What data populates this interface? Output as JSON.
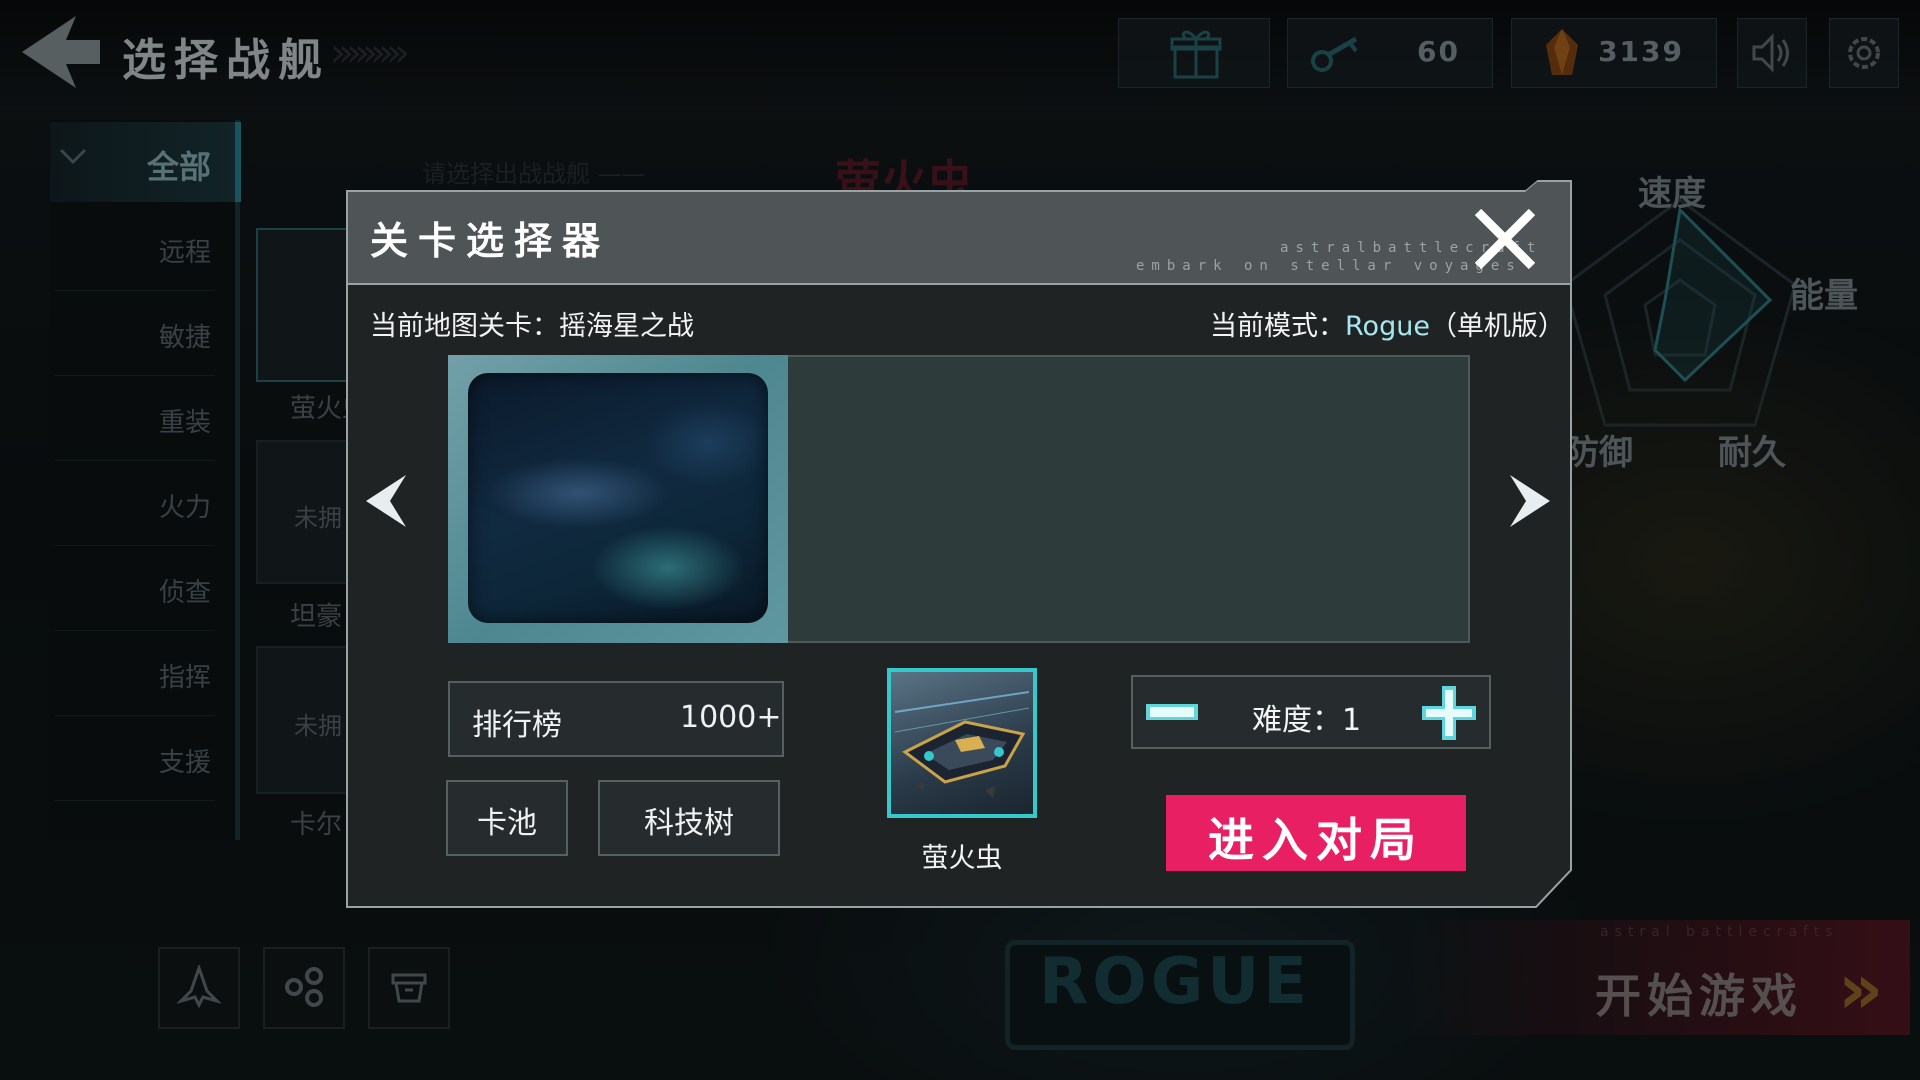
{
  "header": {
    "title": "选择战舰",
    "resources": [
      {
        "icon": "gift-icon",
        "value": ""
      },
      {
        "icon": "key-icon",
        "value": "60"
      },
      {
        "icon": "crystal-icon",
        "value": "3139"
      }
    ]
  },
  "sidebar": {
    "items": [
      {
        "label": "全部",
        "active": true
      },
      {
        "label": "远程"
      },
      {
        "label": "敏捷"
      },
      {
        "label": "重装"
      },
      {
        "label": "火力"
      },
      {
        "label": "侦查"
      },
      {
        "label": "指挥"
      },
      {
        "label": "支援"
      }
    ]
  },
  "background": {
    "select_prompt": "请选择出战战舰 ——",
    "ship_name": "萤火虫",
    "ship_cards": [
      {
        "label": "萤火虫",
        "unowned_text": ""
      },
      {
        "label": "坦豪",
        "unowned_text": "未拥"
      },
      {
        "label": "卡尔",
        "unowned_text": "未拥"
      }
    ],
    "stats": [
      "速度",
      "能量",
      "防御",
      "耐久"
    ],
    "rogue_label": "ROGUE",
    "start_label": "开始游戏",
    "start_tagline": "astral battlecrafts"
  },
  "modal": {
    "title": "关卡选择器",
    "subtitle_line1": "astralbattlecraft",
    "subtitle_line2": "embark on stellar voyages",
    "map_level_label": "当前地图关卡：摇海星之战",
    "mode_prefix": "当前模式：",
    "mode_value": "Rogue",
    "mode_suffix": "（单机版）",
    "leaderboard_label": "排行榜",
    "leaderboard_value": "1000+",
    "card_pool_label": "卡池",
    "tech_tree_label": "科技树",
    "ship_name": "萤火虫",
    "difficulty_label": "难度：",
    "difficulty_value": "1",
    "enter_button": "进入对局"
  },
  "colors": {
    "accent": "#35c9cc",
    "enter_button": "#e91f63",
    "mode_value": "#a8e6ee"
  }
}
